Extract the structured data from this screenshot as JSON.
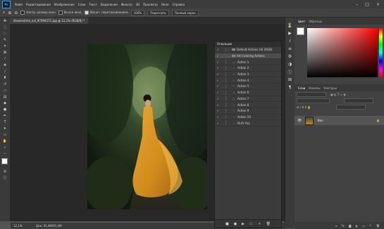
{
  "menubar": {
    "logo": "Ps",
    "items": [
      "Файл",
      "Редактирование",
      "Изображение",
      "Слои",
      "Текст",
      "Выделение",
      "Фильтр",
      "3D",
      "Просмотр",
      "Окно",
      "Справка"
    ],
    "window_controls": [
      "–",
      "□",
      "×"
    ]
  },
  "options": {
    "resize_windows": "Настр. размер окон",
    "all_windows": "Во все окна",
    "scrubby_zoom": "Масшт. перетаскиванием",
    "zoom_value": "100%",
    "fit_button": "Подогнать",
    "fill_button": "Полный экран"
  },
  "document": {
    "tab_title": "dreamstime_xxl_97494271.jpg @ 12,1% (RGB/8) *",
    "zoom_status": "12,1%",
    "size_status": "Док: 91,4M/91,4M"
  },
  "actions_panel": {
    "title": "Операции",
    "rows": [
      {
        "label": "Default Actions (4) (RGB)",
        "type": "set"
      },
      {
        "label": "Art Coloring Actions",
        "type": "set"
      },
      {
        "label": "Action 1",
        "type": "action"
      },
      {
        "label": "Action 2",
        "type": "action"
      },
      {
        "label": "Action 3",
        "type": "action"
      },
      {
        "label": "Action 4",
        "type": "action"
      },
      {
        "label": "Action 5",
        "type": "action"
      },
      {
        "label": "Action 6",
        "type": "action"
      },
      {
        "label": "Action 7",
        "type": "action"
      },
      {
        "label": "Action 8",
        "type": "action"
      },
      {
        "label": "Action 9",
        "type": "action"
      },
      {
        "label": "Action 10",
        "type": "action"
      },
      {
        "label": "PLAY ALL",
        "type": "action"
      }
    ]
  },
  "color_panel": {
    "tabs": [
      "Цвет",
      "Образцы"
    ],
    "hue": "#ff0000"
  },
  "layers_panel": {
    "tabs": [
      "Слои",
      "Каналы",
      "Контуры"
    ],
    "layer_name": "Фон"
  },
  "colors": {
    "accent": "#31a8ff",
    "panel": "#424242",
    "dark": "#282828"
  }
}
